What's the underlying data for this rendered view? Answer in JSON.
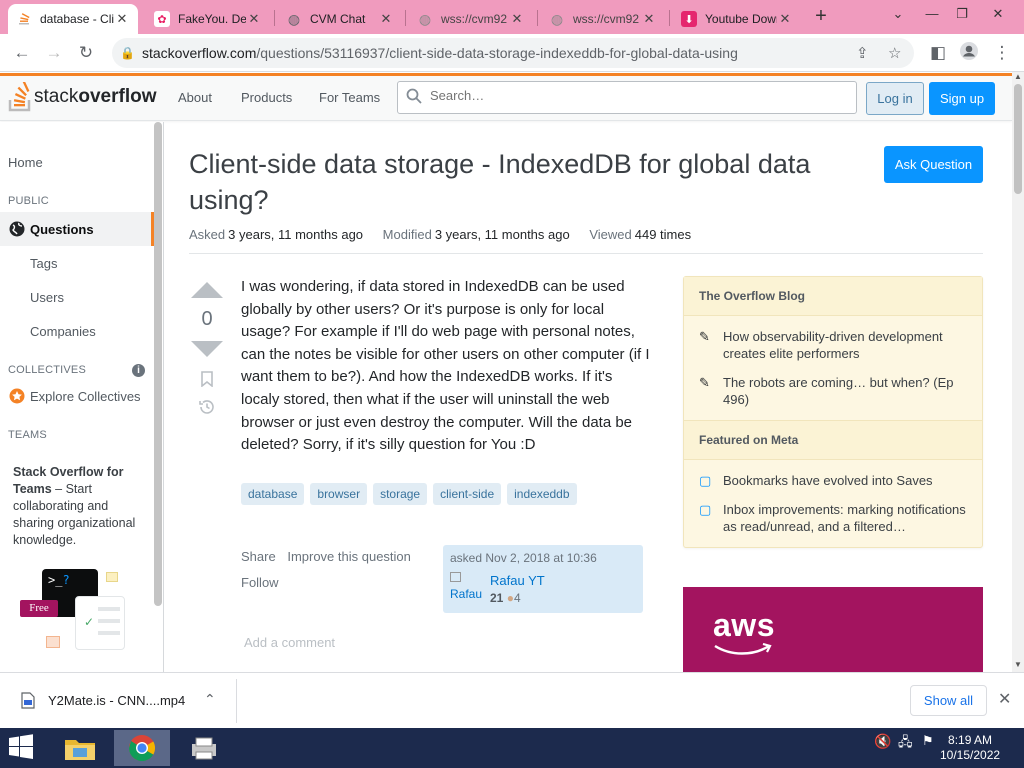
{
  "browser": {
    "tabs": [
      {
        "title": "database - Client-side",
        "icon": "stack-overflow-icon",
        "active": true
      },
      {
        "title": "FakeYou. Deep",
        "icon": "fakeyou-icon"
      },
      {
        "title": "CVM Chat",
        "icon": "globe-icon"
      },
      {
        "title": "wss://cvm92",
        "icon": "globe-icon"
      },
      {
        "title": "wss://cvm92",
        "icon": "globe-icon"
      },
      {
        "title": "Youtube Down",
        "icon": "download-icon"
      }
    ],
    "url_domain": "stackoverflow.com",
    "url_path": "/questions/53116937/client-side-data-storage-indexeddb-for-global-data-using"
  },
  "so_header": {
    "logo_stack": "stack",
    "logo_overflow": "overflow",
    "nav": [
      "About",
      "Products",
      "For Teams"
    ],
    "search_placeholder": "Search…",
    "login": "Log in",
    "signup": "Sign up"
  },
  "left_nav": {
    "home": "Home",
    "public_heading": "PUBLIC",
    "questions": "Questions",
    "tags": "Tags",
    "users": "Users",
    "companies": "Companies",
    "collectives_heading": "COLLECTIVES",
    "explore_collectives": "Explore Collectives",
    "teams_heading": "TEAMS",
    "teams_title": "Stack Overflow for Teams",
    "teams_desc": " – Start collaborating and sharing organizational knowledge.",
    "free_badge": "Free"
  },
  "question": {
    "title": "Client-side data storage - IndexedDB for global data using?",
    "ask_button": "Ask Question",
    "asked_label": "Asked",
    "asked_value": "3 years, 11 months ago",
    "modified_label": "Modified",
    "modified_value": "3 years, 11 months ago",
    "viewed_label": "Viewed",
    "viewed_value": "449 times",
    "votes": "0",
    "body": "I was wondering, if data stored in IndexedDB can be used globally by other users? Or it's purpose is only for local usage? For example if I'll do web page with personal notes, can the notes be visible for other users on other computer (if I want them to be?). And how the IndexedDB works. If it's localy stored, then what if the user will uninstall the web browser or just even destroy the computer. Will the data be deleted? Sorry, if it's silly question for You :D",
    "tags": [
      "database",
      "browser",
      "storage",
      "client-side",
      "indexeddb"
    ],
    "share": "Share",
    "improve": "Improve this question",
    "follow": "Follow",
    "asked_on": "asked Nov 2, 2018 at 10:36",
    "user_name": "Rafau YT",
    "avatar_alt": "Rafau",
    "user_rep": "21",
    "user_bronze": "4",
    "add_comment": "Add a comment"
  },
  "sidebar": {
    "blog_heading": "The Overflow Blog",
    "blog_items": [
      "How observability-driven development creates elite performers",
      "The robots are coming… but when? (Ep 496)"
    ],
    "meta_heading": "Featured on Meta",
    "meta_items": [
      "Bookmarks have evolved into Saves",
      "Inbox improvements: marking notifications as read/unread, and a filtered…"
    ],
    "ad_text": "aws"
  },
  "download_bar": {
    "file": "Y2Mate.is - CNN....mp4",
    "show_all": "Show all"
  },
  "taskbar": {
    "time": "8:19 AM",
    "date": "10/15/2022"
  }
}
